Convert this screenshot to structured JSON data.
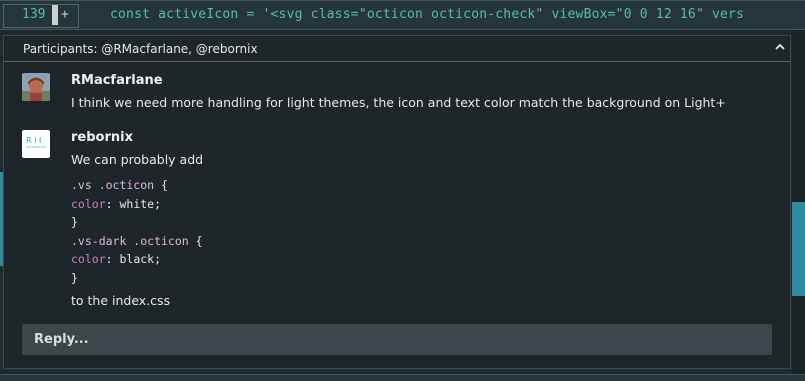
{
  "editor": {
    "line_number": "139",
    "gutter_marker": "+",
    "code_text": "const activeIcon = '<svg class=\"octicon octicon-check\" viewBox=\"0 0 12 16\" vers"
  },
  "thread": {
    "participants_label": "Participants: @RMacfarlane, @rebornix",
    "comments": [
      {
        "author": "RMacfarlane",
        "body": "I think we need more handling for light themes, the icon and text color match the background on Light+"
      },
      {
        "author": "rebornix",
        "body": "We can probably add",
        "code": {
          "line1_selector": ".vs .octicon",
          "line1_brace": " {",
          "line2_prop": "color",
          "line2_value": ": white;",
          "line3": "}",
          "line4_selector": ".vs-dark .octicon",
          "line4_brace": " {",
          "line5_prop": "color",
          "line5_value": ": black;",
          "line6": "}"
        },
        "footer": "to the index.css"
      }
    ],
    "reply_label": "Reply..."
  },
  "colors": {
    "accent": "#2c8da0",
    "code_keyword": "#c586c0"
  }
}
